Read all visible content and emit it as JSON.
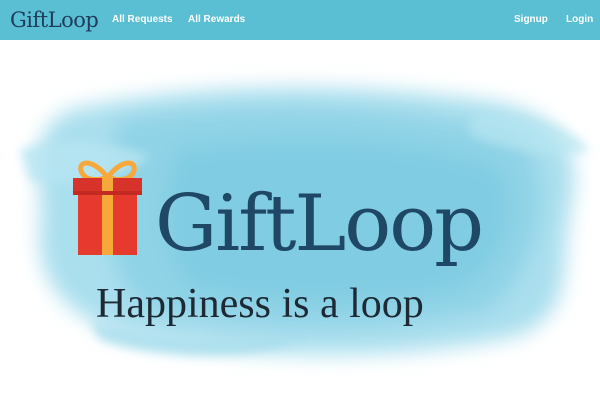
{
  "navbar": {
    "brand": "GiftLoop",
    "links": {
      "requests": "All Requests",
      "rewards": "All Rewards",
      "signup": "Signup",
      "login": "Login"
    }
  },
  "hero": {
    "logo_text": "GiftLoop",
    "tagline": "Happiness is a loop",
    "gift_icon": "gift-box-icon"
  },
  "colors": {
    "navbar": "#5bbfd3",
    "logo_text": "#1f4766",
    "watercolor": "#8fd3e6",
    "gift_box": "#e63a2e",
    "gift_ribbon": "#f7a83a"
  }
}
